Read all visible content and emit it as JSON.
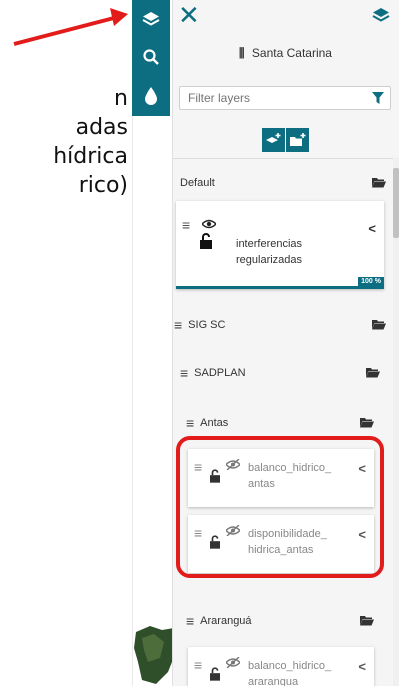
{
  "slide_text": {
    "lines": [
      "n",
      "adas",
      "hídrica",
      "rico)"
    ]
  },
  "toolbar": {
    "items": [
      {
        "name": "layers",
        "icon": "layers-icon",
        "active": true
      },
      {
        "name": "search",
        "icon": "search-icon",
        "active": false
      },
      {
        "name": "water",
        "icon": "water-drop-icon",
        "active": false
      }
    ]
  },
  "panel": {
    "title": "Santa Catarina",
    "filter_placeholder": "Filter layers",
    "tree": {
      "default_group": "Default",
      "default_layer": {
        "line1": "interferencias",
        "line2": "regularizadas",
        "progress": "100 %"
      },
      "sig_group": "SIG SC",
      "sadplan_group": "SADPLAN",
      "antas_group": "Antas",
      "antas_layer1": {
        "line1": "balanco_hidrico_",
        "line2": "antas"
      },
      "antas_layer2": {
        "line1": "disponibilidade_",
        "line2": "hidrica_antas"
      },
      "ararangua_group": "Araranguá",
      "ararangua_layer1": {
        "line1": "balanco_hidrico_",
        "line2": "ararangua"
      }
    }
  },
  "colors": {
    "accent": "#0d6e82",
    "highlight": "#e21b1b"
  }
}
